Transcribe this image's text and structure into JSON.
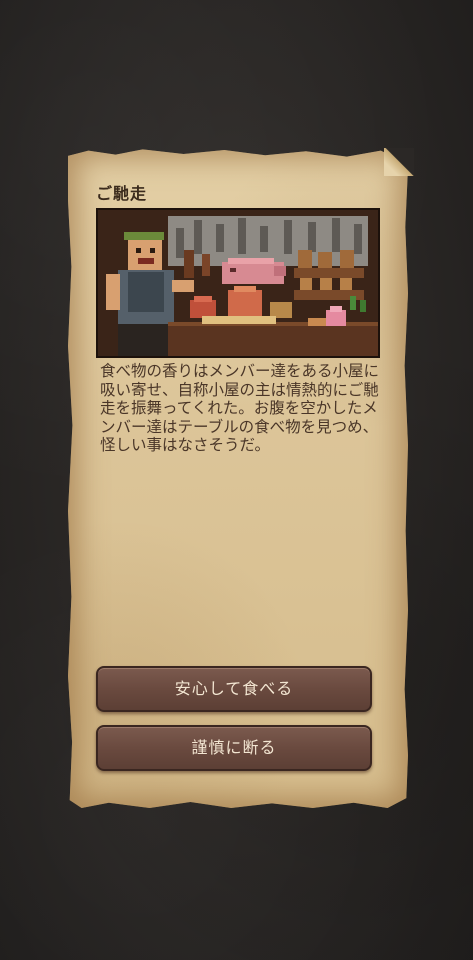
{
  "event": {
    "title": "ご馳走",
    "illustration": "pixel-art-feast-scene",
    "description": "食べ物の香りはメンバー達をある小屋に吸い寄せ、自称小屋の主は情熱的にご馳走を振舞ってくれた。お腹を空かしたメンバー達はテーブルの食べ物を見つめ、怪しい事はなさそうだ。"
  },
  "choices": [
    {
      "label": "安心して食べる"
    },
    {
      "label": "謹慎に断る"
    }
  ],
  "colors": {
    "parchment": "#dcc599",
    "button": "#6a4a3f",
    "button_text": "#f3e6d2",
    "text": "#4a3628"
  }
}
